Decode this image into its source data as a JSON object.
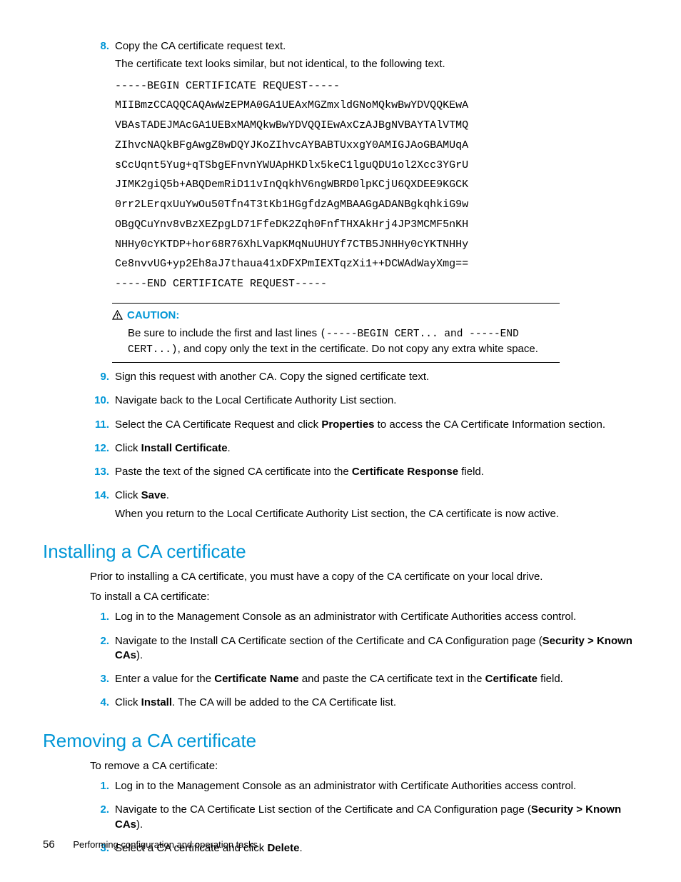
{
  "step8": {
    "num": "8.",
    "line1": "Copy the CA certificate request text.",
    "line2": "The certificate text looks similar, but not identical, to the following text.",
    "code": "-----BEGIN CERTIFICATE REQUEST-----\nMIIBmzCCAQQCAQAwWzEPMA0GA1UEAxMGZmxldGNoMQkwBwYDVQQKEwA\nVBAsTADEJMAcGA1UEBxMAMQkwBwYDVQQIEwAxCzAJBgNVBAYTAlVTMQ\nZIhvcNAQkBFgAwgZ8wDQYJKoZIhvcAYBABTUxxgY0AMIGJAoGBAMUqA\nsCcUqnt5Yug+qTSbgEFnvnYWUApHKDlx5keC1lguQDU1ol2Xcc3YGrU\nJIMK2giQ5b+ABQDemRiD11vInQqkhV6ngWBRD0lpKCjU6QXDEE9KGCK\n0rr2LErqxUuYwOu50Tfn4T3tKb1HGgfdzAgMBAAGgADANBgkqhkiG9w\nOBgQCuYnv8vBzXEZpgLD71FfeDK2Zqh0FnfTHXAkHrj4JP3MCMF5nKH\nNHHy0cYKTDP+hor68R76XhLVapKMqNuUHUYf7CTB5JNHHy0cYKTNHHy\nCe8nvvUG+yp2Eh8aJ7thaua41xDFXPmIEXTqzXi1++DCWAdWayXmg==\n-----END CERTIFICATE REQUEST-----"
  },
  "caution": {
    "label": "CAUTION:",
    "p1a": "Be sure to include the first and last lines ",
    "p1b": "(-----BEGIN CERT...",
    "p1c": "  and  ",
    "p1d": "-----END",
    "p2a": "CERT...)",
    "p2b": ", and copy only the text in the certificate. Do not copy any extra white space."
  },
  "steps9_14": [
    {
      "num": "9.",
      "text_plain": "Sign this request with another CA. Copy the signed certificate text."
    },
    {
      "num": "10.",
      "text_plain": "Navigate back to the Local Certificate Authority List section."
    },
    {
      "num": "11.",
      "pre": "Select the CA Certificate Request and click ",
      "bold": "Properties",
      "post": " to access the CA Certificate Information section."
    },
    {
      "num": "12.",
      "pre": "Click ",
      "bold": "Install Certificate",
      "post": "."
    },
    {
      "num": "13.",
      "pre": "Paste the text of the signed CA certificate into the ",
      "bold": "Certificate Response",
      "post": " field."
    },
    {
      "num": "14.",
      "pre": "Click ",
      "bold": "Save",
      "post": ".",
      "p2": "When you return to the Local Certificate Authority List section, the CA certificate is now active."
    }
  ],
  "h2_install": "Installing a CA certificate",
  "install_intro1": "Prior to installing a CA certificate, you must have a copy of the CA certificate on your local drive.",
  "install_intro2": "To install a CA certificate:",
  "install_steps": [
    {
      "num": "1.",
      "text_plain": "Log in to the Management Console as an administrator with Certificate Authorities access control."
    },
    {
      "num": "2.",
      "pre": "Navigate to the Install CA Certificate section of the Certificate and CA Configuration page (",
      "bold": "Security > Known CAs",
      "post": ")."
    },
    {
      "num": "3.",
      "pre": "Enter a value for the ",
      "bold": "Certificate Name",
      "mid": " and paste the CA certificate text in the ",
      "bold2": "Certificate",
      "post": " field."
    },
    {
      "num": "4.",
      "pre": "Click ",
      "bold": "Install",
      "post": ".  The CA will be added to the CA Certificate list."
    }
  ],
  "h2_remove": "Removing a CA certificate",
  "remove_intro": "To remove a CA certificate:",
  "remove_steps": [
    {
      "num": "1.",
      "text_plain": "Log in to the Management Console as an administrator with Certificate Authorities access control."
    },
    {
      "num": "2.",
      "pre": "Navigate to the CA Certificate List section of the Certificate and CA Configuration page (",
      "bold": "Security > Known CAs",
      "post": ")."
    },
    {
      "num": "3.",
      "pre": "Select a CA certificate and click ",
      "bold": "Delete",
      "post": "."
    }
  ],
  "footer": {
    "page_number": "56",
    "chapter": "Performing configuration and operation tasks"
  }
}
